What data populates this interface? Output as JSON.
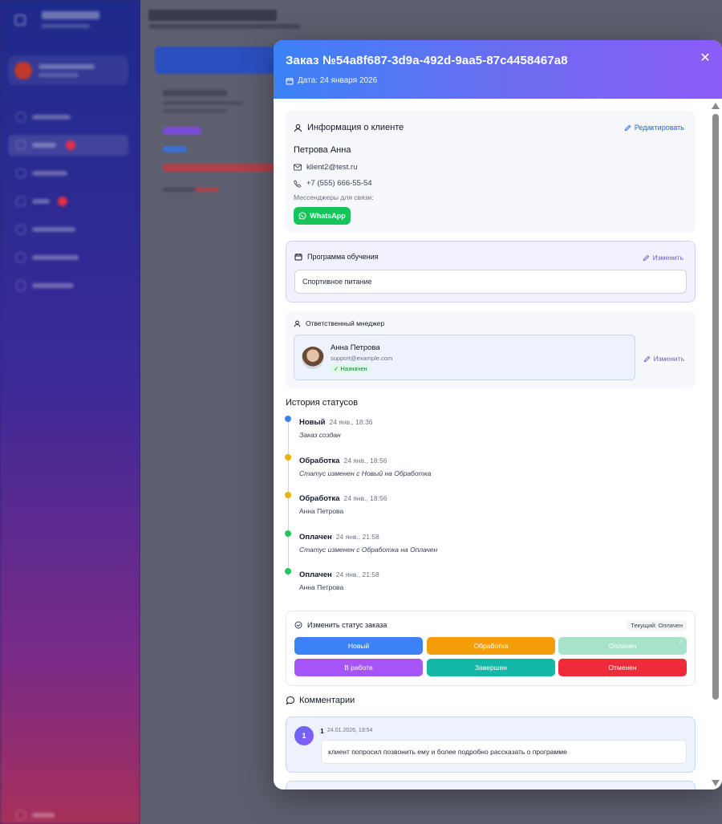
{
  "modal": {
    "title": "Заказ №54a8f687-3d9a-492d-9aa5-87c4458467a8",
    "date": "Дата: 24 января 2026",
    "close_icon": "✕"
  },
  "client": {
    "section_title": "Информация о клиенте",
    "edit_label": "Редактировать",
    "name": "Петрова Анна",
    "email": "klient2@test.ru",
    "phone": "+7 (555) 666-55-54",
    "messengers_label": "Мессенджеры для связи:",
    "whatsapp_label": "WhatsApp"
  },
  "program": {
    "section_title": "Программа обучения",
    "edit_label": "Изменить",
    "value": "Спортивное питание"
  },
  "manager": {
    "section_title": "Ответственный мнеджер",
    "name": "Анна Петрова",
    "email": "support@example.com",
    "badge": "✓ Назначен",
    "edit_label": "Изменить"
  },
  "history": {
    "title": "История статусов",
    "items": [
      {
        "status": "Новый",
        "time": "24 янв., 18:36",
        "desc": "Заказ создан",
        "color": "#3b82f6"
      },
      {
        "status": "Обработка",
        "time": "24 янв., 18:56",
        "desc": "Статус изменен с Новый на Обработка",
        "color": "#eab308"
      },
      {
        "status": "Обработка",
        "time": "24 янв., 18:56",
        "desc": "Анна Петрова",
        "color": "#eab308"
      },
      {
        "status": "Оплачен",
        "time": "24 янв., 21:58",
        "desc": "Статус изменен с Обработка на Оплачен",
        "color": "#22c55e"
      },
      {
        "status": "Оплачен",
        "time": "24 янв., 21:58",
        "desc": "Анна Петрова",
        "color": "#22c55e"
      }
    ]
  },
  "status_change": {
    "section_title": "Изменить статус заказа",
    "current": "Текущий: Оплачен",
    "buttons": [
      {
        "label": "Новый",
        "color": "#3b82f6"
      },
      {
        "label": "Обработка",
        "color": "#f59e0b"
      },
      {
        "label": "Оплачен",
        "color": "#a7e3c8"
      },
      {
        "label": "В работе",
        "color": "#a855f7"
      },
      {
        "label": "Завершен",
        "color": "#14b8a6"
      },
      {
        "label": "Отменен",
        "color": "#ef2b3a"
      }
    ]
  },
  "comments": {
    "title": "Комментарии",
    "items": [
      {
        "avatar": "1",
        "author": "1",
        "date": "24.01.2026, 19:54",
        "text": "клиент попросил позвонить ему и более подробно рассказать о программе"
      }
    ]
  }
}
